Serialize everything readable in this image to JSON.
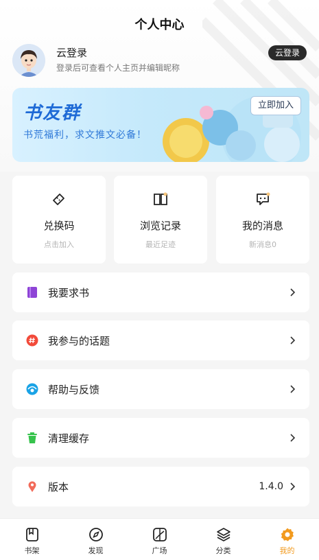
{
  "header": {
    "title": "个人中心"
  },
  "user": {
    "name": "云登录",
    "hint": "登录后可查看个人主页并编辑昵称",
    "login_button": "云登录"
  },
  "banner": {
    "title": "书友群",
    "subtitle": "书荒福利，求文推文必备！",
    "join_button": "立即加入"
  },
  "cards": [
    {
      "label": "兑换码",
      "sub": "点击加入",
      "icon": "ticket-icon"
    },
    {
      "label": "浏览记录",
      "sub": "最近足迹",
      "icon": "book-open-icon"
    },
    {
      "label": "我的消息",
      "sub": "新消息0",
      "icon": "message-icon"
    }
  ],
  "menu": [
    {
      "label": "我要求书",
      "icon": "book-request-icon",
      "color": "#8e44d6"
    },
    {
      "label": "我参与的话题",
      "icon": "topic-icon",
      "color": "#f24a3a"
    },
    {
      "label": "帮助与反馈",
      "icon": "help-icon",
      "color": "#1aa3e6"
    },
    {
      "label": "清理缓存",
      "icon": "trash-icon",
      "color": "#36c34c"
    },
    {
      "label": "版本",
      "value": "1.4.0",
      "icon": "location-pin-icon",
      "color": "#f26b5a"
    }
  ],
  "tabs": [
    {
      "label": "书架",
      "icon": "bookshelf-icon"
    },
    {
      "label": "发现",
      "icon": "compass-icon"
    },
    {
      "label": "广场",
      "icon": "plaza-icon"
    },
    {
      "label": "分类",
      "icon": "layers-icon"
    },
    {
      "label": "我的",
      "icon": "gear-icon",
      "active": true
    }
  ],
  "colors": {
    "accent": "#f29a1e",
    "banner_blue": "#1e6ad6"
  }
}
